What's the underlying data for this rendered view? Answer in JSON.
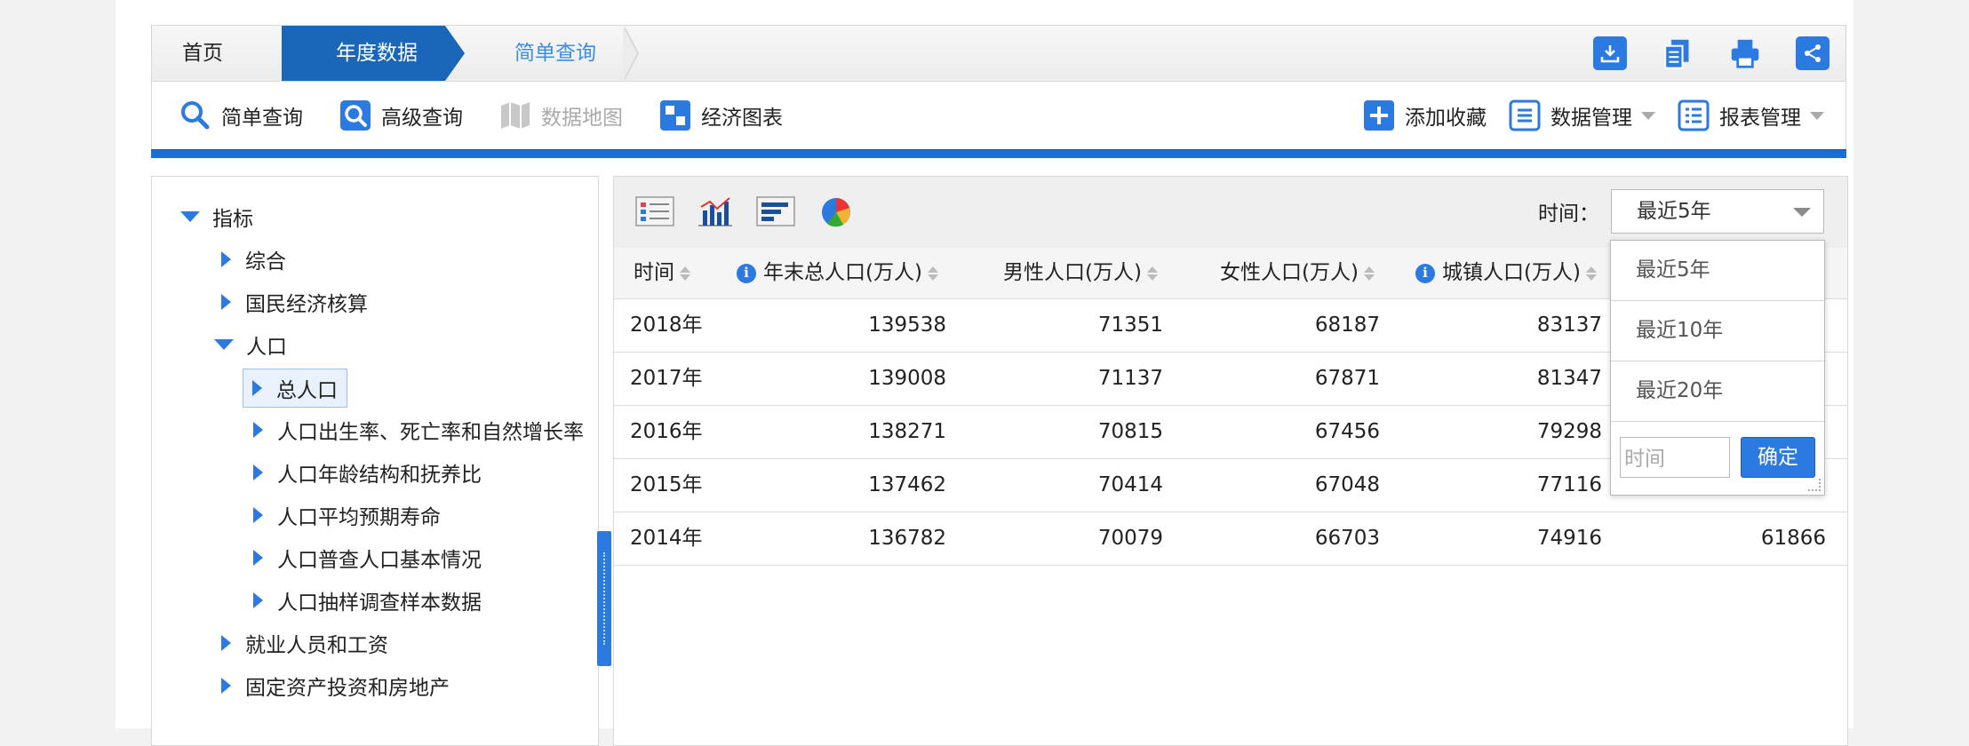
{
  "breadcrumb": {
    "home": "首页",
    "active": "年度数据",
    "current": "简单查询"
  },
  "top_icons": [
    "download-icon",
    "copy-icon",
    "print-icon",
    "share-icon"
  ],
  "toolbar": {
    "simple_query": "简单查询",
    "advanced_query": "高级查询",
    "data_map": "数据地图",
    "econ_chart": "经济图表",
    "add_favorite": "添加收藏",
    "data_manage": "数据管理",
    "report_manage": "报表管理"
  },
  "tree": {
    "root": "指标",
    "items": [
      "综合",
      "国民经济核算",
      "人口",
      "总人口",
      "人口出生率、死亡率和自然增长率",
      "人口年龄结构和抚养比",
      "人口平均预期寿命",
      "人口普查人口基本情况",
      "人口抽样调查样本数据",
      "就业人员和工资",
      "固定资产投资和房地产"
    ]
  },
  "panel": {
    "time_label": "时间：",
    "time_selected": "最近5年",
    "headers": [
      "时间",
      "年末总人口(万人)",
      "男性人口(万人)",
      "女性人口(万人)",
      "城镇人口(万人)"
    ],
    "rows": [
      [
        "2018年",
        "139538",
        "71351",
        "68187",
        "83137",
        ""
      ],
      [
        "2017年",
        "139008",
        "71137",
        "67871",
        "81347",
        ""
      ],
      [
        "2016年",
        "138271",
        "70815",
        "67456",
        "79298",
        ""
      ],
      [
        "2015年",
        "137462",
        "70414",
        "67048",
        "77116",
        ""
      ],
      [
        "2014年",
        "136782",
        "70079",
        "66703",
        "74916",
        "61866"
      ]
    ]
  },
  "dropdown": {
    "options": [
      "最近5年",
      "最近10年",
      "最近20年"
    ],
    "input_placeholder": "时间",
    "ok": "确定"
  },
  "colors": {
    "brand_blue": "#1a66b8",
    "accent_blue": "#2a7ae2",
    "link_blue": "#3c8ee0"
  }
}
